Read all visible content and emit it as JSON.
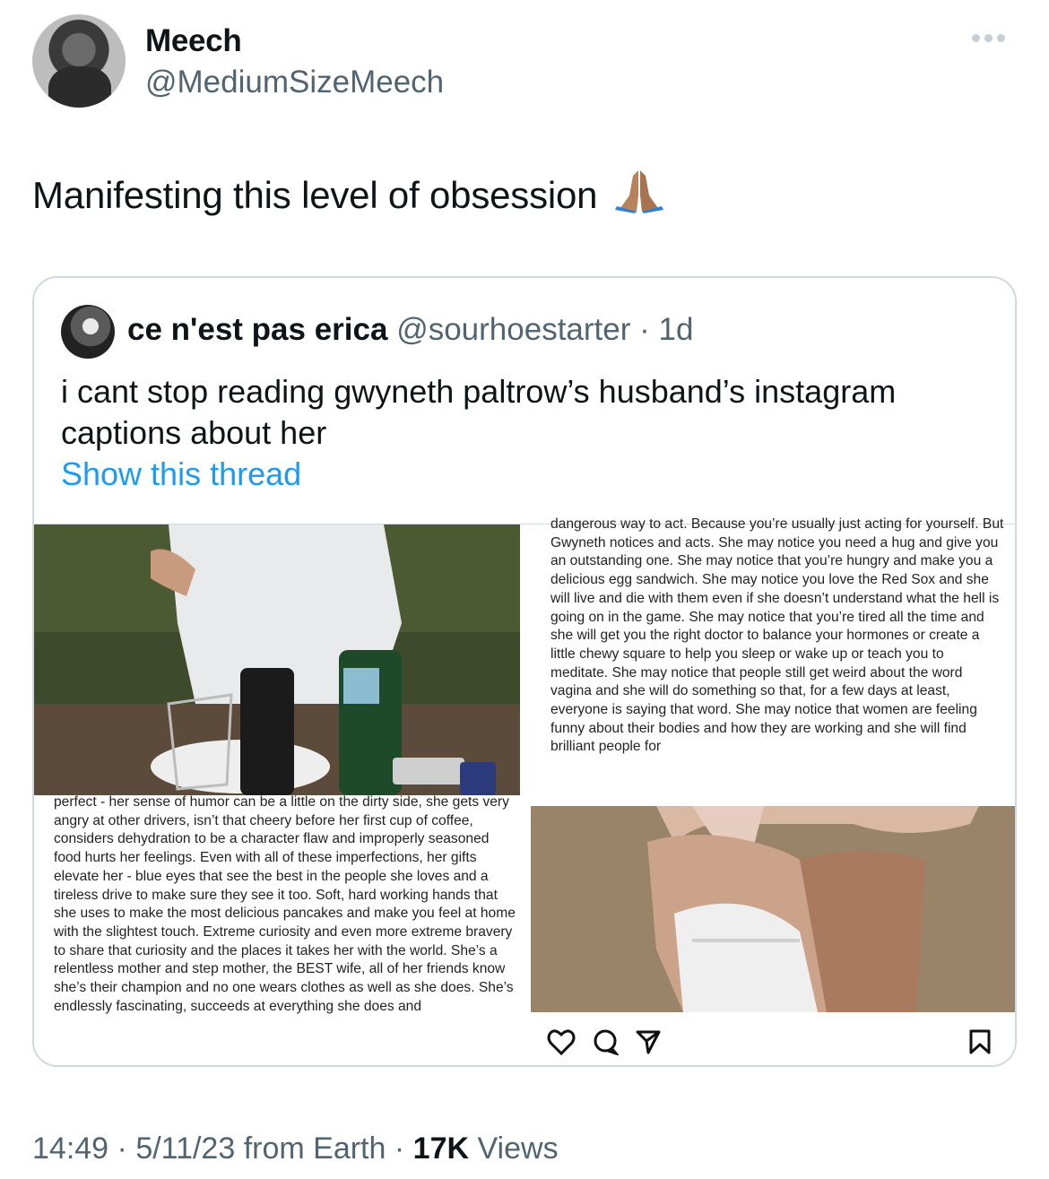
{
  "author": {
    "name": "Meech",
    "handle": "@MediumSizeMeech"
  },
  "tweet": {
    "text": "Manifesting this level of obsession",
    "emoji_icon": "folded-hands-icon"
  },
  "quoted": {
    "name": "ce n'est pas erica",
    "handle": "@sourhoestarter",
    "separator": "·",
    "age": "1d",
    "text": "i cant stop reading gwyneth paltrow’s husband’s instagram captions about her",
    "show_thread": "Show this thread",
    "caption_right": "dangerous way to act. Because you’re usually just acting for yourself. But Gwyneth notices and acts. She may notice you need a hug and give you an outstanding one. She may notice that you’re hungry and make you a delicious egg sandwich. She may notice you love the Red Sox and she will live and die with them even if she doesn’t understand what the hell is going on in the game. She may notice that you’re tired all the time and she will get you the right doctor to balance your hormones or create a little chewy square to help you sleep or wake up or teach you to meditate. She may notice that people still get weird about the word vagina and she will do something so that, for a few days at least, everyone is saying that word. She may notice that women are feeling funny about their bodies and how they are working and she will find brilliant people for",
    "caption_left": "perfect - her sense of humor can be a little on the dirty side, she gets very angry at other drivers, isn’t that cheery before her first cup of coffee, considers dehydration to be a character flaw and improperly seasoned food hurts her feelings. Even with all of these imperfections, her gifts elevate her - blue eyes that see the best in the people she loves and a tireless drive to make sure they see it too. Soft, hard working hands that she uses to make the most delicious pancakes and make you feel at home with the slightest touch. Extreme curiosity and even more extreme bravery to share that curiosity and the places it takes her with the world. She’s a relentless mother and step mother, the BEST wife, all of her friends know she’s their champion and no one wears clothes as well as she does. She’s endlessly fascinating, succeeds at everything she does and"
  },
  "footer": {
    "time": "14:49",
    "dot1": "·",
    "date": "5/11/23",
    "source": "from Earth",
    "dot2": "·",
    "views_count": "17K",
    "views_label": "Views"
  },
  "colors": {
    "link": "#1d9bf0",
    "secondary_text": "#536471",
    "border": "#cfd9de"
  }
}
